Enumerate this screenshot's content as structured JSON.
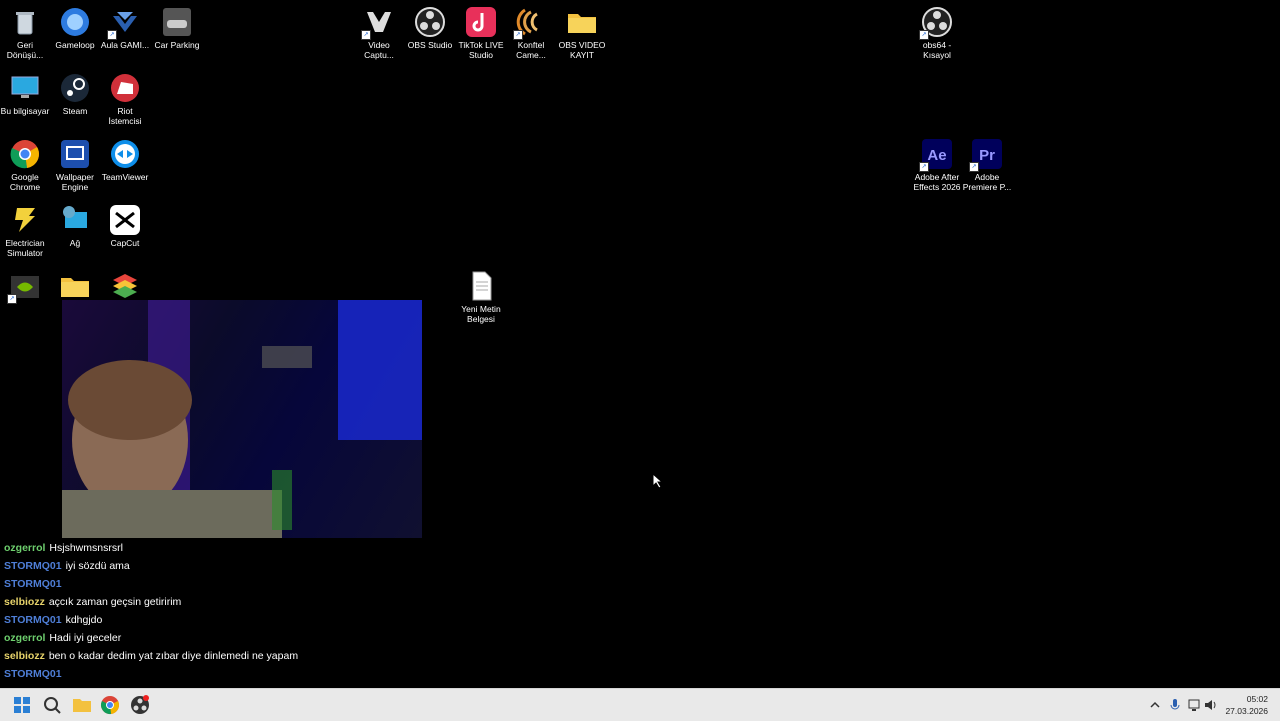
{
  "desktop_icons": [
    {
      "label": "Geri Dönüşü...",
      "icon": "recycle-bin-icon"
    },
    {
      "label": "Gameloop",
      "icon": "gameloop-icon"
    },
    {
      "label": "Aula GAMI...",
      "icon": "aula-icon"
    },
    {
      "label": "Car Parking",
      "icon": "car-parking-icon"
    },
    {
      "label": "Video Captu...",
      "icon": "video-capture-icon"
    },
    {
      "label": "OBS Studio",
      "icon": "obs-icon"
    },
    {
      "label": "TikTok LIVE Studio",
      "icon": "tiktok-icon"
    },
    {
      "label": "Konftel Came...",
      "icon": "konftel-icon"
    },
    {
      "label": "OBS VIDEO KAYIT",
      "icon": "folder-icon"
    },
    {
      "label": "obs64 - Kısayol",
      "icon": "obs-icon"
    },
    {
      "label": "Bu bilgisayar",
      "icon": "computer-icon"
    },
    {
      "label": "Steam",
      "icon": "steam-icon"
    },
    {
      "label": "Riot İstemcisi",
      "icon": "riot-icon"
    },
    {
      "label": "Google Chrome",
      "icon": "chrome-icon"
    },
    {
      "label": "Wallpaper Engine",
      "icon": "wallpaper-engine-icon"
    },
    {
      "label": "TeamViewer",
      "icon": "teamviewer-icon"
    },
    {
      "label": "Adobe After Effects 2026",
      "icon": "after-effects-icon"
    },
    {
      "label": "Adobe Premiere P...",
      "icon": "premiere-icon"
    },
    {
      "label": "Electrician Simulator",
      "icon": "electrician-icon"
    },
    {
      "label": "Ağ",
      "icon": "network-icon"
    },
    {
      "label": "CapCut",
      "icon": "capcut-icon"
    },
    {
      "label": "",
      "icon": "nvidia-icon"
    },
    {
      "label": "",
      "icon": "folder-icon"
    },
    {
      "label": "",
      "icon": "bluestacks-icon"
    },
    {
      "label": "Yeni Metin Belgesi",
      "icon": "text-file-icon"
    }
  ],
  "chat": [
    {
      "user": "ozgerrol",
      "user_color": "#6ecf6e",
      "text": "Hsjshwmsnsrsrl"
    },
    {
      "user": "STORMQ01",
      "user_color": "#4f7fd8",
      "text": "iyi sözdü ama"
    },
    {
      "user": "STORMQ01",
      "user_color": "#4f7fd8",
      "text": ""
    },
    {
      "user": "selbiozz",
      "user_color": "#e7d36a",
      "text": "açcık zaman geçsin getiririm"
    },
    {
      "user": "STORMQ01",
      "user_color": "#4f7fd8",
      "text": "kdhgjdo"
    },
    {
      "user": "ozgerrol",
      "user_color": "#6ecf6e",
      "text": "Hadi iyi geceler"
    },
    {
      "user": "selbiozz",
      "user_color": "#e7d36a",
      "text": "ben o kadar dedim yat zıbar diye dinlemedi ne yapam"
    },
    {
      "user": "STORMQ01",
      "user_color": "#4f7fd8",
      "text": ""
    },
    {
      "user": "STORMQ01",
      "user_color": "#4f7fd8",
      "text": ""
    }
  ],
  "taskbar": {
    "time": "05:02",
    "date": "27.03.2026"
  }
}
